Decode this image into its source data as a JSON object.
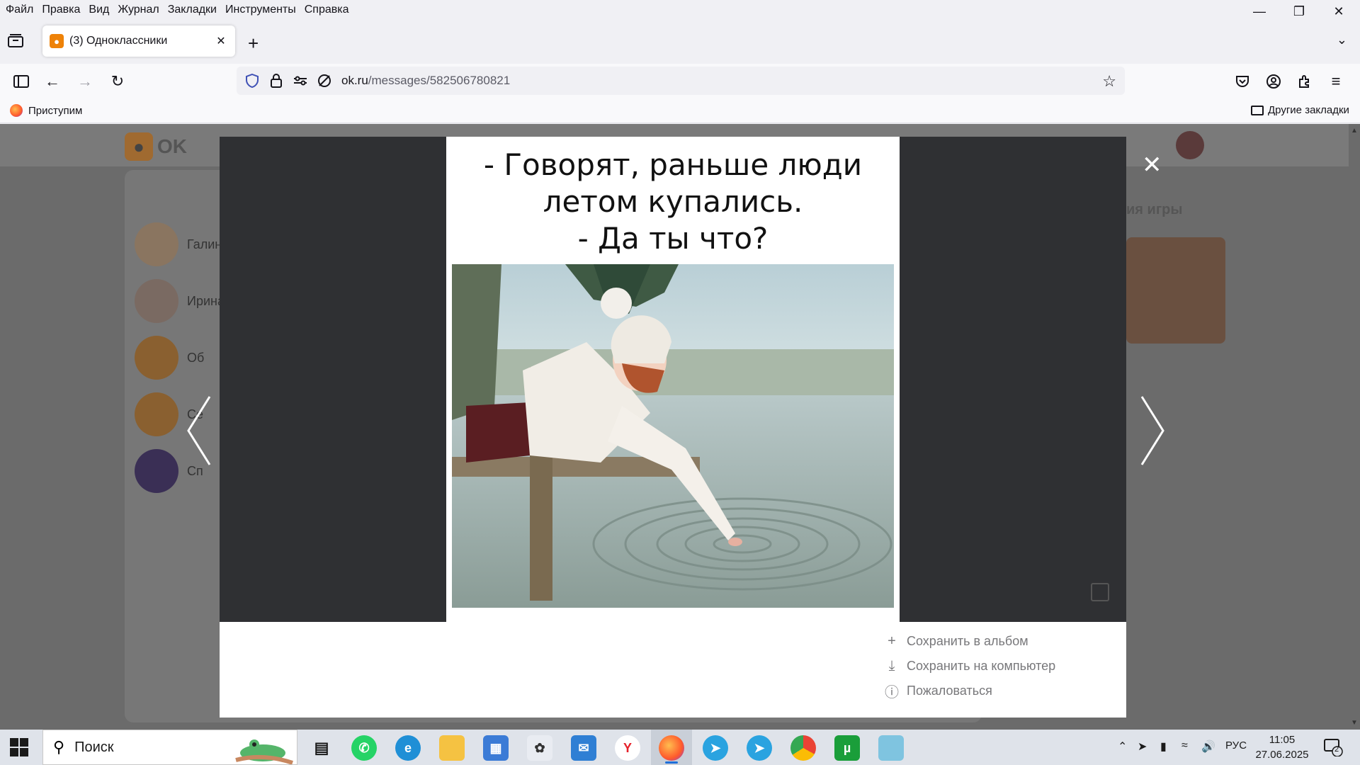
{
  "menu": [
    "Файл",
    "Правка",
    "Вид",
    "Журнал",
    "Закладки",
    "Инструменты",
    "Справка"
  ],
  "tab": {
    "title": "(3) Одноклассники",
    "favicon": "ok-logo-icon"
  },
  "url": {
    "host": "ok.ru",
    "path": "/messages/582506780821"
  },
  "bookmarks": {
    "first": "Приступим",
    "other": "Другие закладки"
  },
  "ok": {
    "logo": "OK",
    "games_label": "ия игры",
    "rows": [
      "Галин",
      "Ирина",
      "Об",
      "Се",
      "Сп"
    ]
  },
  "viewer": {
    "caption_lines": [
      "- Говорят, раньше люди",
      "летом купались.",
      "- Да ты что?"
    ],
    "actions": [
      "Сохранить в альбом",
      "Сохранить на компьютер",
      "Пожаловаться"
    ]
  },
  "taskbar": {
    "search": "Поиск",
    "lang": "РУС",
    "time": "11:05",
    "date": "27.06.2025",
    "notifications": "2",
    "apps": [
      "whatsapp",
      "edge",
      "file-explorer",
      "store",
      "paint",
      "outlook",
      "yandex",
      "firefox",
      "telegram",
      "telegram",
      "chrome",
      "utorrent",
      "notepad"
    ]
  },
  "colors": {
    "ok_orange": "#ee8208",
    "overlay_dark": "#2f3033",
    "accent": "#1e6fd9"
  }
}
